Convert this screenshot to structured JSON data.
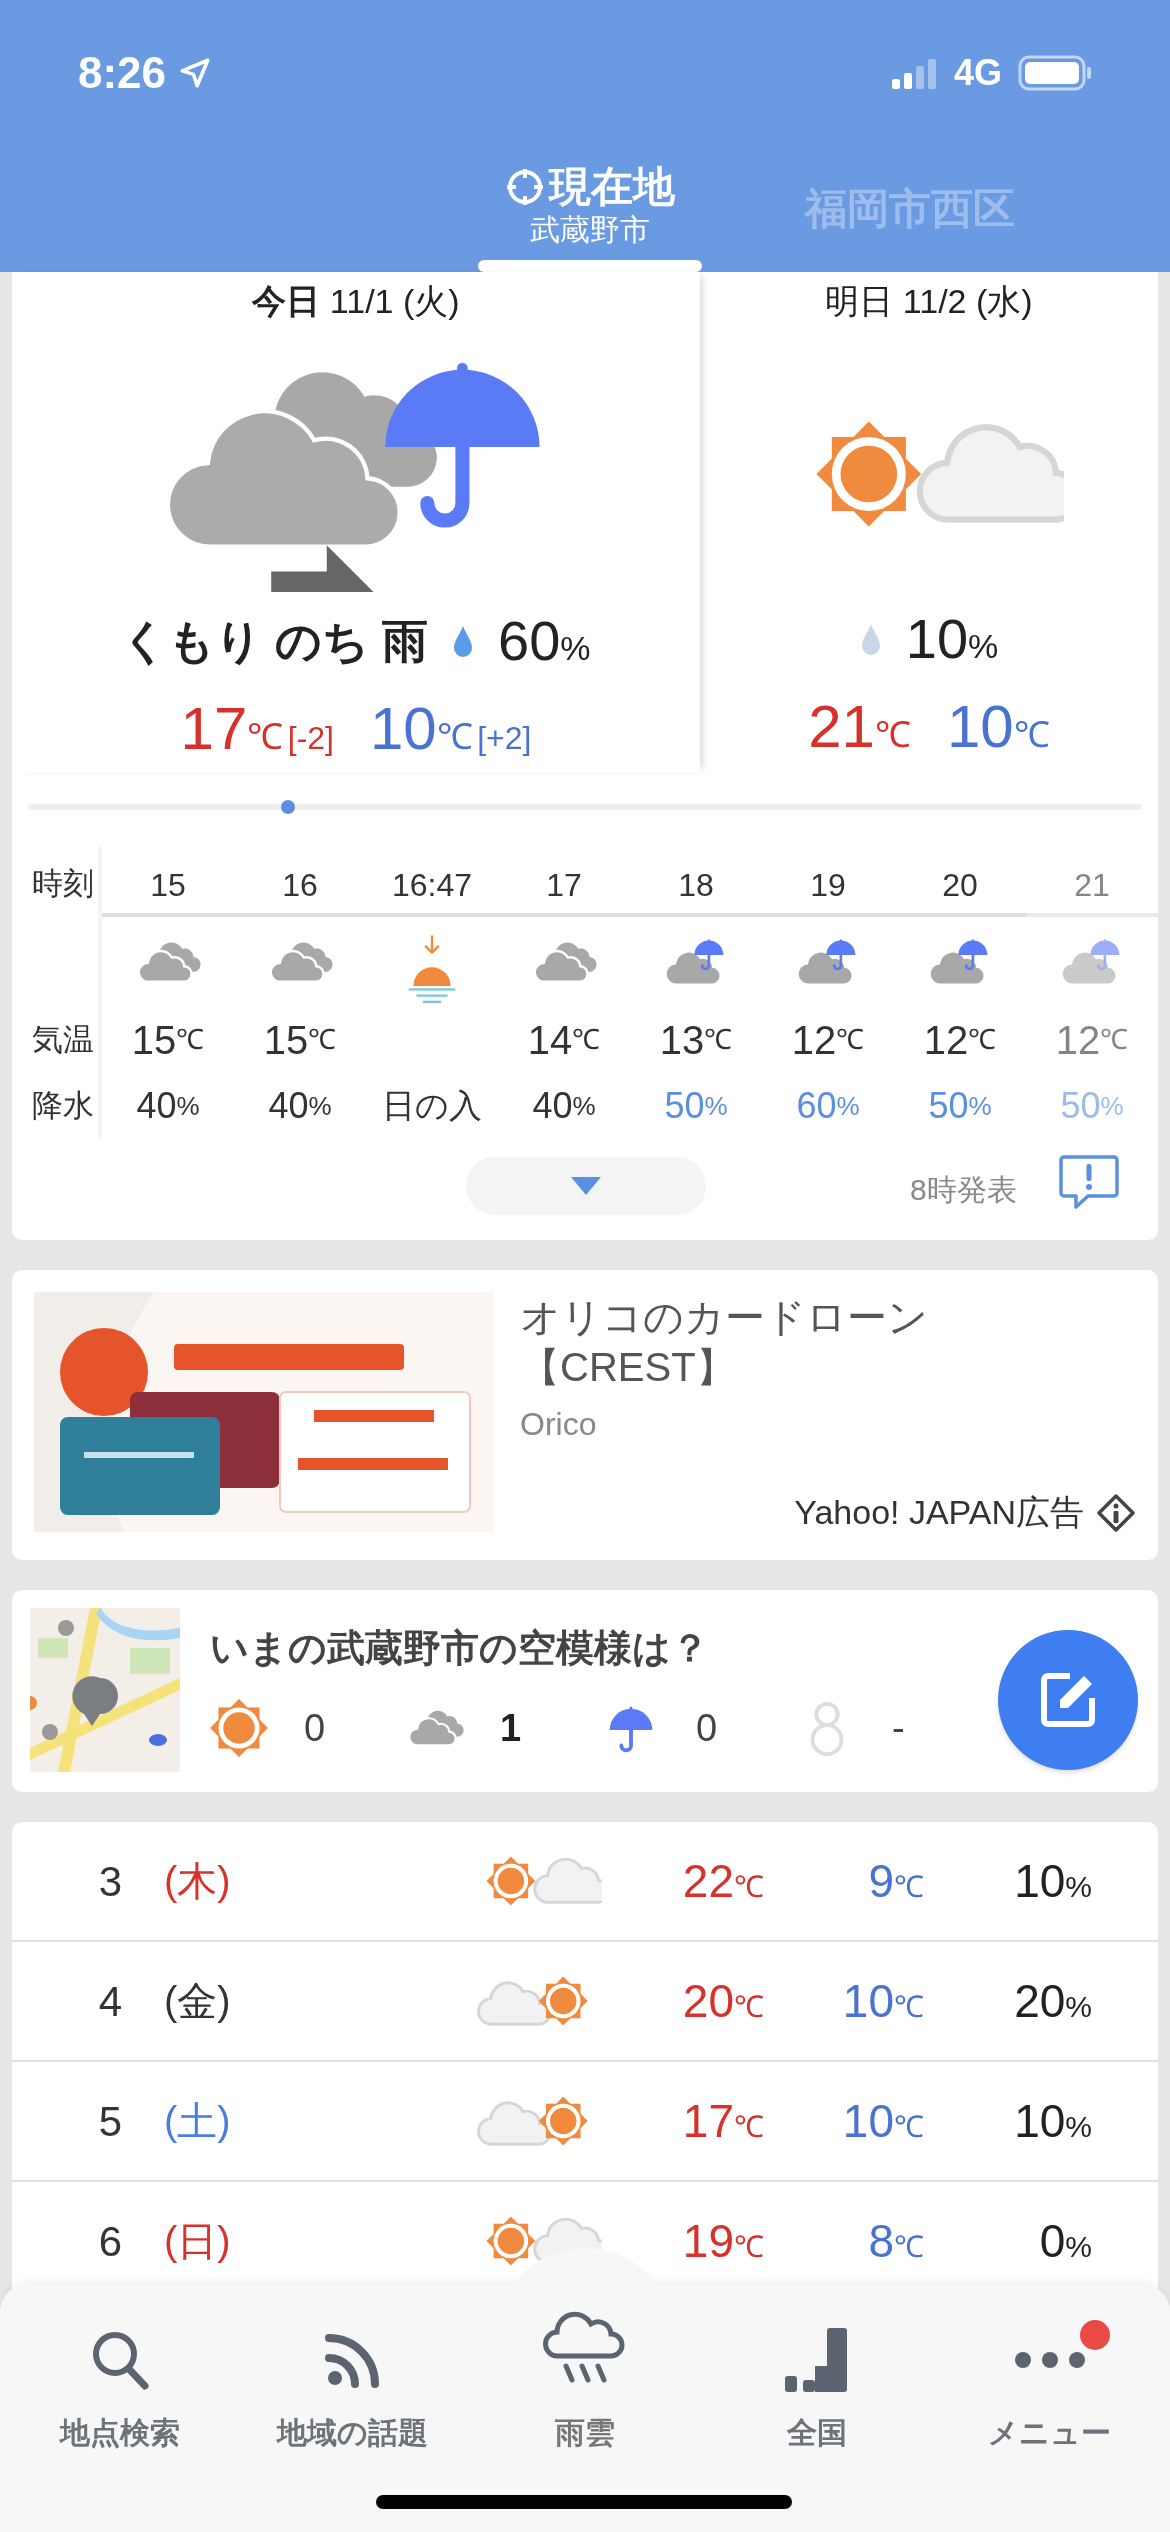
{
  "status_bar": {
    "time": "8:26",
    "network": "4G"
  },
  "location_tabs": [
    {
      "label": "現在地",
      "sublabel": "武蔵野市",
      "selected": true,
      "kind": "current"
    },
    {
      "label": "福岡市西区",
      "selected": false,
      "kind": "place"
    }
  ],
  "days": [
    {
      "label": "今日",
      "date": "11/1 (火)",
      "kind": "cloudy_then_rain",
      "condition": "くもり のち 雨",
      "precip": "60%",
      "high": "17℃",
      "high_diff": "[-2]",
      "low": "10℃",
      "low_diff": "[+2]"
    },
    {
      "label": "明日",
      "date": "11/2 (水)",
      "kind": "sunny_cloudy",
      "precip": "10%",
      "high": "21℃",
      "low": "10℃"
    }
  ],
  "hourly": {
    "row_labels": [
      "時刻",
      "気温",
      "降水"
    ],
    "hours": [
      {
        "time": "15",
        "kind": "cloudy",
        "temp": "15℃",
        "precip": "40%",
        "highlight": false
      },
      {
        "time": "16",
        "kind": "cloudy",
        "temp": "15℃",
        "precip": "40%",
        "highlight": false
      },
      {
        "time": "16:47",
        "kind": "sunset",
        "precip": "日の入"
      },
      {
        "time": "17",
        "kind": "cloudy",
        "temp": "14℃",
        "precip": "40%",
        "highlight": false
      },
      {
        "time": "18",
        "kind": "cloudy_rain",
        "temp": "13℃",
        "precip": "50%",
        "highlight": true
      },
      {
        "time": "19",
        "kind": "cloudy_rain",
        "temp": "12℃",
        "precip": "60%",
        "highlight": true
      },
      {
        "time": "20",
        "kind": "cloudy_rain",
        "temp": "12℃",
        "precip": "50%",
        "highlight": true
      },
      {
        "time": "21",
        "kind": "cloudy_rain",
        "temp": "12℃",
        "precip": "50%",
        "highlight": true
      }
    ],
    "issued": "8時発表"
  },
  "ad": {
    "title_lines": [
      "オリコのカードローン",
      "【CREST】"
    ],
    "advertiser": "Orico",
    "label": "Yahoo! JAPAN広告"
  },
  "sky_poll": {
    "title": "いまの武蔵野市の空模様は？",
    "options": [
      {
        "kind": "sunny",
        "count": "0",
        "highlight": false
      },
      {
        "kind": "cloudy",
        "count": "1",
        "highlight": true
      },
      {
        "kind": "rain",
        "count": "0",
        "highlight": false
      },
      {
        "kind": "snow",
        "count": "-",
        "highlight": false
      }
    ]
  },
  "daily": [
    {
      "day": "3",
      "weekday": "(木)",
      "color": "#d6322b",
      "kind": "sunny_cloudy",
      "high": "22℃",
      "low": "9℃",
      "precip": "10%"
    },
    {
      "day": "4",
      "weekday": "(金)",
      "color": "#333333",
      "kind": "cloudy_sunny",
      "high": "20℃",
      "low": "10℃",
      "precip": "20%"
    },
    {
      "day": "5",
      "weekday": "(土)",
      "color": "#4a7de0",
      "kind": "cloudy_sunny",
      "high": "17℃",
      "low": "10℃",
      "precip": "10%"
    },
    {
      "day": "6",
      "weekday": "(日)",
      "color": "#d6322b",
      "kind": "sunny_cloudy",
      "high": "19℃",
      "low": "8℃",
      "precip": "0%"
    }
  ],
  "tab_bar": [
    {
      "label": "地点検索",
      "kind": "search",
      "badge": false
    },
    {
      "label": "地域の話題",
      "kind": "topics",
      "badge": false
    },
    {
      "label": "雨雲",
      "kind": "rain",
      "badge": false
    },
    {
      "label": "全国",
      "kind": "national",
      "badge": false
    },
    {
      "label": "メニュー",
      "kind": "menu",
      "badge": true
    }
  ]
}
